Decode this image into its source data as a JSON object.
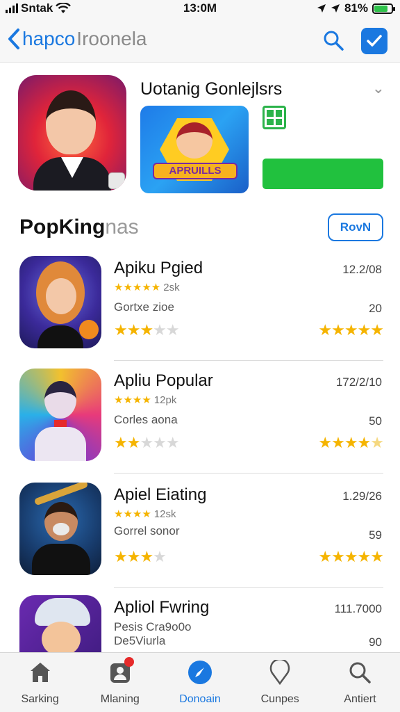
{
  "status_bar": {
    "carrier": "Sntak",
    "time": "13:0M",
    "battery": "81%"
  },
  "nav": {
    "back_label": "hapco",
    "title_rest": "Iroonela"
  },
  "featured": {
    "title": "Uotanig Gonlejlsrs",
    "game_label": "APRUILLS"
  },
  "section": {
    "title": "PopKing",
    "title_faded": "nas",
    "button": "RovN"
  },
  "apps": [
    {
      "name": "Apiku Pgied",
      "date": "12.2/08",
      "rating_count": "2sk",
      "rating_stars": 5,
      "sub": "Gortxe zioe",
      "num": "20",
      "left_stars": 3,
      "right_stars": 5
    },
    {
      "name": "Apliu Popular",
      "date": "172/2/10",
      "rating_count": "12pk",
      "rating_stars": 4,
      "sub": "Corles aona",
      "num": "50",
      "left_stars": 2,
      "right_stars": 4.5
    },
    {
      "name": "Apiel Eiating",
      "date": "1.29/26",
      "rating_count": "12sk",
      "rating_stars": 4,
      "sub": "Gorrel sonor",
      "num": "59",
      "left_stars": 3,
      "right_stars": 5
    },
    {
      "name": "Apliol Fwring",
      "date": "111.7000",
      "rating_count": "",
      "rating_stars": 0,
      "sub": "Pesis Cra9o0o",
      "sub2": "De5Viurla",
      "num": "90",
      "left_stars": 0,
      "right_stars": 0
    }
  ],
  "tabs": [
    {
      "label": "Sarking",
      "icon": "home-icon"
    },
    {
      "label": "Mlaning",
      "icon": "profile-icon",
      "badge": true
    },
    {
      "label": "Donoain",
      "icon": "compass-icon",
      "active": true
    },
    {
      "label": "Cunpes",
      "icon": "location-icon"
    },
    {
      "label": "Antiert",
      "icon": "search-icon"
    }
  ],
  "colors": {
    "accent": "#1a78e0",
    "get_button": "#21c13e",
    "star": "#f5b400",
    "badge": "#e62a2a"
  }
}
